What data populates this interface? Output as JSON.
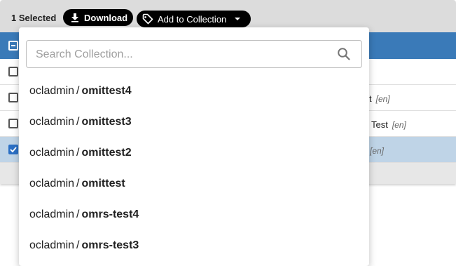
{
  "toolbar": {
    "selected_count": "1 Selected",
    "download_label": "Download",
    "add_to_collection_label": "Add to Collection"
  },
  "table": {
    "rows": [
      {
        "text": "",
        "lang": ""
      },
      {
        "text": "t",
        "lang": "[en]"
      },
      {
        "text": "Test",
        "lang": "[en]"
      },
      {
        "text": "",
        "lang": "[en]"
      }
    ]
  },
  "search": {
    "placeholder": "Search Collection...",
    "value": ""
  },
  "collections": [
    {
      "owner": "ocladmin",
      "separator": "/",
      "name": "omittest4"
    },
    {
      "owner": "ocladmin",
      "separator": "/",
      "name": "omittest3"
    },
    {
      "owner": "ocladmin",
      "separator": "/",
      "name": "omittest2"
    },
    {
      "owner": "ocladmin",
      "separator": "/",
      "name": "omittest"
    },
    {
      "owner": "ocladmin",
      "separator": "/",
      "name": "omrs-test4"
    },
    {
      "owner": "ocladmin",
      "separator": "/",
      "name": "omrs-test3"
    }
  ],
  "colors": {
    "accent": "#3a7ab8",
    "selected_row": "#bfd4e7",
    "pill": "#000000"
  }
}
